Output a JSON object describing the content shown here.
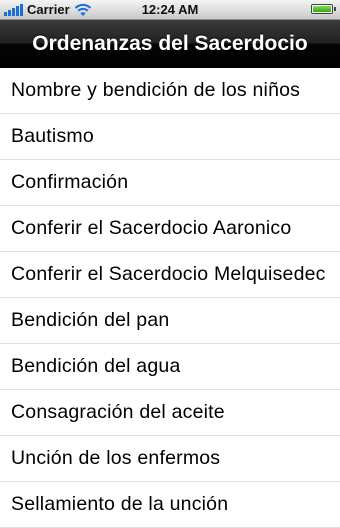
{
  "status_bar": {
    "carrier": "Carrier",
    "time": "12:24 AM"
  },
  "nav": {
    "title": "Ordenanzas del Sacerdocio"
  },
  "list": {
    "items": [
      {
        "label": "Nombre y bendición de los niños"
      },
      {
        "label": "Bautismo"
      },
      {
        "label": "Confirmación"
      },
      {
        "label": "Conferir el Sacerdocio Aaronico"
      },
      {
        "label": "Conferir el Sacerdocio Melquisedec"
      },
      {
        "label": "Bendición del pan"
      },
      {
        "label": "Bendición del agua"
      },
      {
        "label": "Consagración del aceite"
      },
      {
        "label": "Unción de los enfermos"
      },
      {
        "label": "Sellamiento de la unción"
      }
    ]
  },
  "colors": {
    "signal": "#1a6fd1",
    "battery": "#39a61a",
    "navbar": "#000000"
  }
}
